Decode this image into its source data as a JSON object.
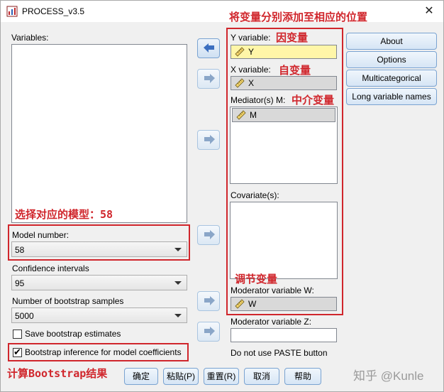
{
  "window": {
    "title": "PROCESS_v3.5",
    "close_glyph": "✕"
  },
  "left": {
    "variables_label": "Variables:",
    "model_number_label": "Model number:",
    "model_number_value": "58",
    "confidence_label": "Confidence intervals",
    "confidence_value": "95",
    "bootstrap_samples_label": "Number of bootstrap samples",
    "bootstrap_samples_value": "5000",
    "save_bootstrap_label": "Save bootstrap estimates",
    "save_bootstrap_checked": false,
    "bootstrap_inference_label": "Bootstrap inference for model coefficients",
    "bootstrap_inference_checked": true
  },
  "middle": {
    "y_label": "Y variable:",
    "y_value": "Y",
    "x_label": "X variable:",
    "x_value": "X",
    "mediator_label": "Mediator(s) M:",
    "mediator_items": [
      "M"
    ],
    "covariates_label": "Covariate(s):",
    "mod_w_label": "Moderator variable W:",
    "mod_w_value": "W",
    "mod_z_label": "Moderator variable Z:",
    "mod_z_value": "",
    "paste_note": "Do not use PASTE button"
  },
  "right_buttons": {
    "about": "About",
    "options": "Options",
    "multicategorical": "Multicategorical",
    "long_names": "Long variable names"
  },
  "bottom_buttons": {
    "ok": "确定",
    "paste": "粘贴(P)",
    "reset": "重置(R)",
    "cancel": "取消",
    "help": "帮助"
  },
  "annotations": {
    "top": "将变量分别添加至相应的位置",
    "y_note": "因变量",
    "x_note": "自变量",
    "m_note": "中介变量",
    "model_note": "选择对应的模型：58",
    "w_note": "调节变量",
    "bootstrap_note": "计算Bootstrap结果"
  },
  "watermark": "知乎 @Kunle",
  "colors": {
    "annotation_red": "#d0262c",
    "y_field_yellow": "#fff6a8",
    "button_blue": "#d6e5f5"
  }
}
